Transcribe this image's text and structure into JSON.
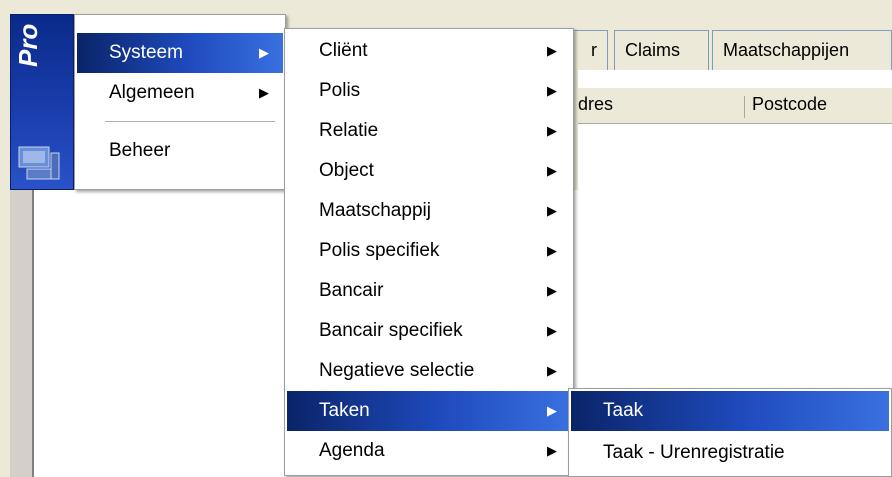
{
  "tabs": [
    "r",
    "Claims",
    "Maatschappijen"
  ],
  "columns": [
    "dres",
    "Postcode"
  ],
  "logo_text": "Pro",
  "menu1": [
    {
      "label": "Systeem",
      "has_submenu": true,
      "selected": true
    },
    {
      "label": "Algemeen",
      "has_submenu": true,
      "selected": false
    },
    {
      "label": "Beheer",
      "has_submenu": false,
      "selected": false
    }
  ],
  "menu2": [
    {
      "label": "Cliënt",
      "has_submenu": true,
      "selected": false
    },
    {
      "label": "Polis",
      "has_submenu": true,
      "selected": false
    },
    {
      "label": "Relatie",
      "has_submenu": true,
      "selected": false
    },
    {
      "label": "Object",
      "has_submenu": true,
      "selected": false
    },
    {
      "label": "Maatschappij",
      "has_submenu": true,
      "selected": false
    },
    {
      "label": "Polis specifiek",
      "has_submenu": true,
      "selected": false
    },
    {
      "label": "Bancair",
      "has_submenu": true,
      "selected": false
    },
    {
      "label": "Bancair specifiek",
      "has_submenu": true,
      "selected": false
    },
    {
      "label": "Negatieve selectie",
      "has_submenu": true,
      "selected": false
    },
    {
      "label": "Taken",
      "has_submenu": true,
      "selected": true
    },
    {
      "label": "Agenda",
      "has_submenu": true,
      "selected": false
    }
  ],
  "menu3": [
    {
      "label": "Taak",
      "selected": true
    },
    {
      "label": "Taak - Urenregistratie",
      "selected": false
    }
  ],
  "submenu_arrow": "▶",
  "colors": {
    "selection": "#1f4bbf",
    "logo_panel": "#0a2a8a"
  }
}
